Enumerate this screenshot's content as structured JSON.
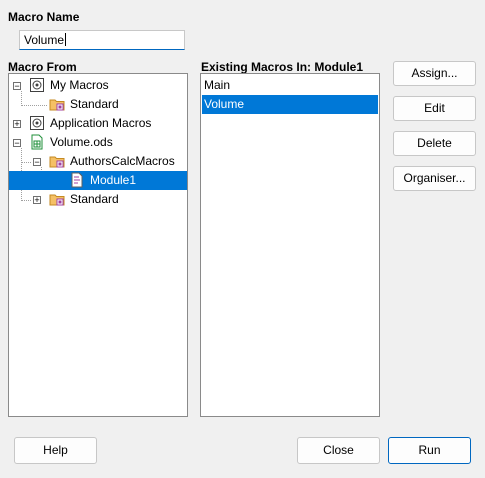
{
  "macro_name": {
    "label": "Macro Name",
    "value": "Volume"
  },
  "macro_from": {
    "label": "Macro From",
    "tree": [
      {
        "label": "My Macros",
        "icon": "macro-library-icon"
      },
      {
        "label": "Standard",
        "icon": "macro-folder-icon"
      },
      {
        "label": "Application Macros",
        "icon": "macro-library-icon"
      },
      {
        "label": "Volume.ods",
        "icon": "spreadsheet-document-icon"
      },
      {
        "label": "AuthorsCalcMacros",
        "icon": "macro-folder-icon"
      },
      {
        "label": "Module1",
        "icon": "basic-module-icon"
      },
      {
        "label": "Standard",
        "icon": "macro-folder-icon"
      }
    ]
  },
  "existing_macros": {
    "label": "Existing Macros In: Module1",
    "items": [
      "Main",
      "Volume"
    ]
  },
  "buttons": {
    "assign": "Assign...",
    "edit": "Edit",
    "delete": "Delete",
    "organiser": "Organiser...",
    "help": "Help",
    "close": "Close",
    "run": "Run"
  }
}
